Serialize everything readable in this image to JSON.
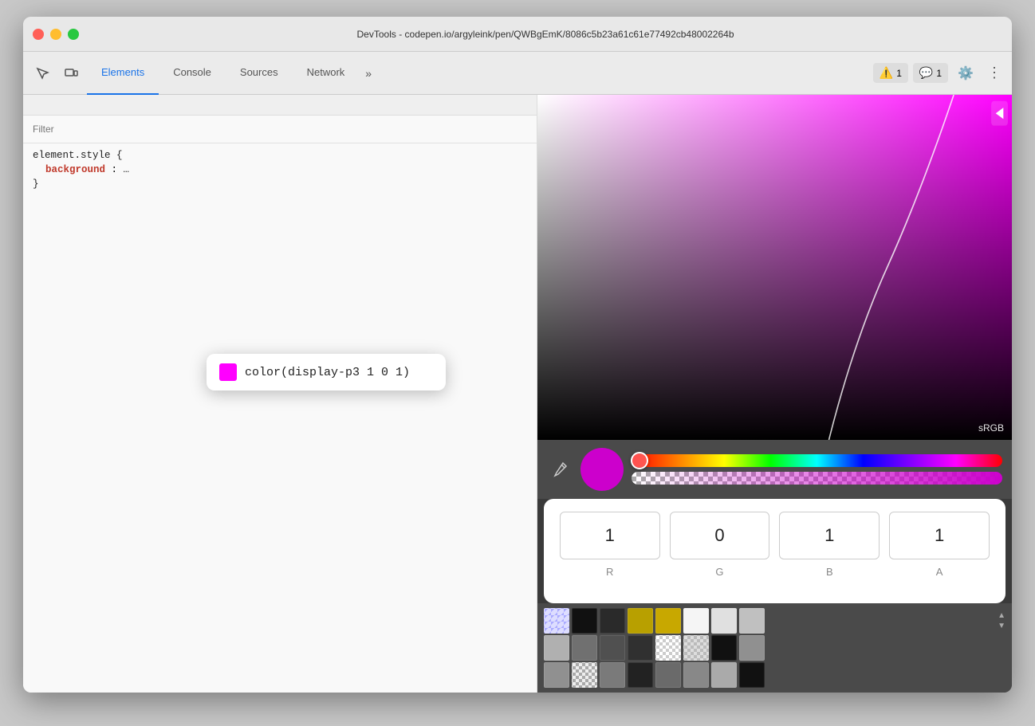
{
  "window": {
    "title": "DevTools - codepen.io/argyleink/pen/QWBgEmK/8086c5b23a61c61e77492cb48002264b"
  },
  "toolbar": {
    "tabs": [
      {
        "id": "elements",
        "label": "Elements",
        "active": true
      },
      {
        "id": "console",
        "label": "Console",
        "active": false
      },
      {
        "id": "sources",
        "label": "Sources",
        "active": false
      },
      {
        "id": "network",
        "label": "Network",
        "active": false
      }
    ],
    "more_tabs_label": "»",
    "warnings_count": "1",
    "messages_count": "1"
  },
  "filter": {
    "placeholder": "Filter",
    "label": "Filter"
  },
  "css": {
    "selector": "element.style {",
    "property": "background",
    "colon": ":",
    "brace_close": "}"
  },
  "tooltip": {
    "color_text": "color(display-p3 1 0 1)"
  },
  "color_picker": {
    "srgb_label": "sRGB",
    "r_value": "1",
    "g_value": "0",
    "b_value": "1",
    "a_value": "1",
    "r_label": "R",
    "g_label": "G",
    "b_label": "B",
    "a_label": "A"
  },
  "swatches": {
    "row1": [
      {
        "bg": "#8080ff",
        "type": "checkered"
      },
      {
        "bg": "#111111"
      },
      {
        "bg": "#2a2a2a"
      },
      {
        "bg": "#b8a000"
      },
      {
        "bg": "#c8a800"
      },
      {
        "bg": "#f5f5f5"
      },
      {
        "bg": "#e0e0e0"
      },
      {
        "bg": "#c0c0c0"
      }
    ],
    "row2": [
      {
        "bg": "#b0b0b0"
      },
      {
        "bg": "#707070"
      },
      {
        "bg": "#505050"
      },
      {
        "bg": "#303030"
      },
      {
        "bg": "#e8e8e8",
        "type": "checkered2"
      },
      {
        "bg": "#d0d0d0",
        "type": "checkered2"
      },
      {
        "bg": "#111111"
      },
      {
        "bg": "#909090"
      }
    ],
    "row3": [
      {
        "bg": "#909090"
      },
      {
        "bg": "#dddddd",
        "type": "checkered3"
      },
      {
        "bg": "#7a7a7a"
      },
      {
        "bg": "#222222"
      },
      {
        "bg": "#6a6a6a"
      },
      {
        "bg": "#888888"
      },
      {
        "bg": "#aaaaaa"
      },
      {
        "bg": "#111111"
      }
    ]
  }
}
